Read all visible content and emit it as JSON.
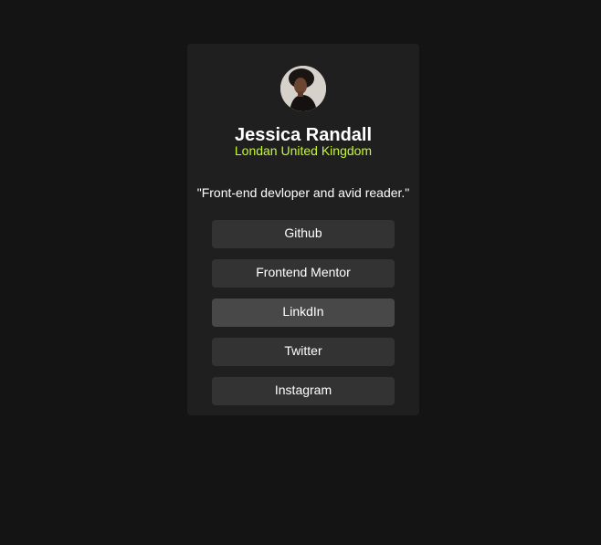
{
  "profile": {
    "name": "Jessica Randall",
    "location": "Londan United Kingdom",
    "bio": "\"Front-end devloper and avid reader.\"",
    "avatar_icon": "person-avatar-icon"
  },
  "links": [
    {
      "label": "Github",
      "highlighted": false
    },
    {
      "label": "Frontend Mentor",
      "highlighted": false
    },
    {
      "label": "LinkdIn",
      "highlighted": true
    },
    {
      "label": "Twitter",
      "highlighted": false
    },
    {
      "label": "Instagram",
      "highlighted": false
    }
  ],
  "colors": {
    "background": "#141414",
    "card": "#1f1f1f",
    "button": "#333333",
    "button_hover": "#484848",
    "accent": "#c4f82a",
    "text": "#ffffff"
  }
}
